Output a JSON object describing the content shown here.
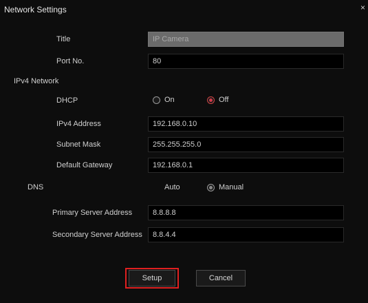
{
  "window": {
    "title": "Network Settings",
    "close_glyph": "×"
  },
  "form": {
    "title_label": "Title",
    "title_value": "IP Camera",
    "port_label": "Port No.",
    "port_value": "80",
    "ipv4_section": "IPv4 Network",
    "dhcp_label": "DHCP",
    "dhcp_on_label": "On",
    "dhcp_off_label": "Off",
    "dhcp_selected": "Off",
    "ipv4_address_label": "IPv4 Address",
    "ipv4_address_value": "192.168.0.10",
    "subnet_label": "Subnet Mask",
    "subnet_value": "255.255.255.0",
    "gateway_label": "Default Gateway",
    "gateway_value": "192.168.0.1",
    "dns_label": "DNS",
    "dns_auto_label": "Auto",
    "dns_manual_label": "Manual",
    "dns_selected": "Manual",
    "primary_dns_label": "Primary Server Address",
    "primary_dns_value": "8.8.8.8",
    "secondary_dns_label": "Secondary Server Address",
    "secondary_dns_value": "8.8.4.4"
  },
  "buttons": {
    "setup": "Setup",
    "cancel": "Cancel"
  },
  "colors": {
    "accent": "#d03a4a",
    "highlight": "#e02020"
  }
}
